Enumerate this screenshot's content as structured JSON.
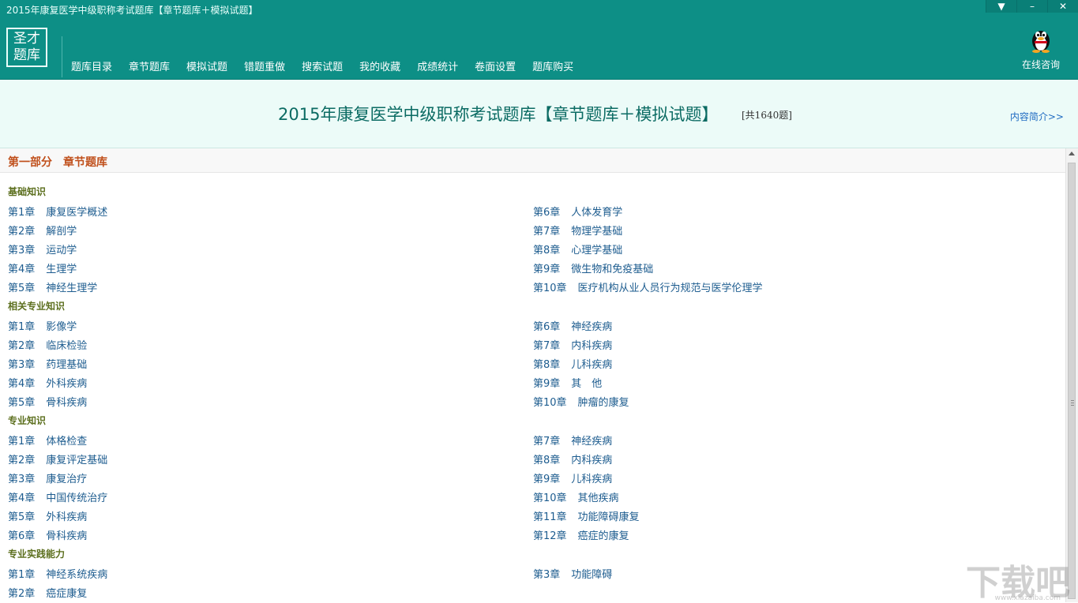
{
  "window": {
    "title": "2015年康复医学中级职称考试题库【章节题库＋模拟试题】",
    "controls": [
      "▼",
      "–",
      "✕"
    ]
  },
  "header": {
    "logo_lines": [
      "圣才",
      "题库"
    ],
    "nav": [
      "题库目录",
      "章节题库",
      "模拟试题",
      "错题重做",
      "搜索试题",
      "我的收藏",
      "成绩统计",
      "卷面设置",
      "题库购买"
    ],
    "consult_label": "在线咨询"
  },
  "banner": {
    "title": "2015年康复医学中级职称考试题库【章节题库＋模拟试题】",
    "count": "[共1640题]",
    "intro_link": "内容简介>>"
  },
  "content": {
    "part_title": "第一部分　章节题库",
    "sections": [
      {
        "title": "基础知识",
        "left": [
          {
            "num": "第1章",
            "name": "康复医学概述"
          },
          {
            "num": "第2章",
            "name": "解剖学"
          },
          {
            "num": "第3章",
            "name": "运动学"
          },
          {
            "num": "第4章",
            "name": "生理学"
          },
          {
            "num": "第5章",
            "name": "神经生理学"
          }
        ],
        "right": [
          {
            "num": "第6章",
            "name": "人体发育学"
          },
          {
            "num": "第7章",
            "name": "物理学基础"
          },
          {
            "num": "第8章",
            "name": "心理学基础"
          },
          {
            "num": "第9章",
            "name": "微生物和免疫基础"
          },
          {
            "num": "第10章",
            "name": "医疗机构从业人员行为规范与医学伦理学"
          }
        ]
      },
      {
        "title": "相关专业知识",
        "left": [
          {
            "num": "第1章",
            "name": "影像学"
          },
          {
            "num": "第2章",
            "name": "临床检验"
          },
          {
            "num": "第3章",
            "name": "药理基础"
          },
          {
            "num": "第4章",
            "name": "外科疾病"
          },
          {
            "num": "第5章",
            "name": "骨科疾病"
          }
        ],
        "right": [
          {
            "num": "第6章",
            "name": "神经疾病"
          },
          {
            "num": "第7章",
            "name": "内科疾病"
          },
          {
            "num": "第8章",
            "name": "儿科疾病"
          },
          {
            "num": "第9章",
            "name": "其　他"
          },
          {
            "num": "第10章",
            "name": "肿瘤的康复"
          }
        ]
      },
      {
        "title": "专业知识",
        "left": [
          {
            "num": "第1章",
            "name": "体格检查"
          },
          {
            "num": "第2章",
            "name": "康复评定基础"
          },
          {
            "num": "第3章",
            "name": "康复治疗"
          },
          {
            "num": "第4章",
            "name": "中国传统治疗"
          },
          {
            "num": "第5章",
            "name": "外科疾病"
          },
          {
            "num": "第6章",
            "name": "骨科疾病"
          }
        ],
        "right": [
          {
            "num": "第7章",
            "name": "神经疾病"
          },
          {
            "num": "第8章",
            "name": "内科疾病"
          },
          {
            "num": "第9章",
            "name": "儿科疾病"
          },
          {
            "num": "第10章",
            "name": "其他疾病"
          },
          {
            "num": "第11章",
            "name": "功能障碍康复"
          },
          {
            "num": "第12章",
            "name": "癌症的康复"
          }
        ]
      },
      {
        "title": "专业实践能力",
        "left": [
          {
            "num": "第1章",
            "name": "神经系统疾病"
          },
          {
            "num": "第2章",
            "name": "癌症康复"
          }
        ],
        "right": [
          {
            "num": "第3章",
            "name": "功能障碍"
          }
        ]
      }
    ]
  },
  "watermark": {
    "text": "下载吧",
    "sub": "www.xiazaiba.com"
  },
  "colors": {
    "header_bg": "#0d8f86",
    "banner_bg": "#ecfbf8",
    "part_title": "#c0501c",
    "section_title": "#5c6f1e",
    "chapter_link": "#1d5c8f"
  }
}
